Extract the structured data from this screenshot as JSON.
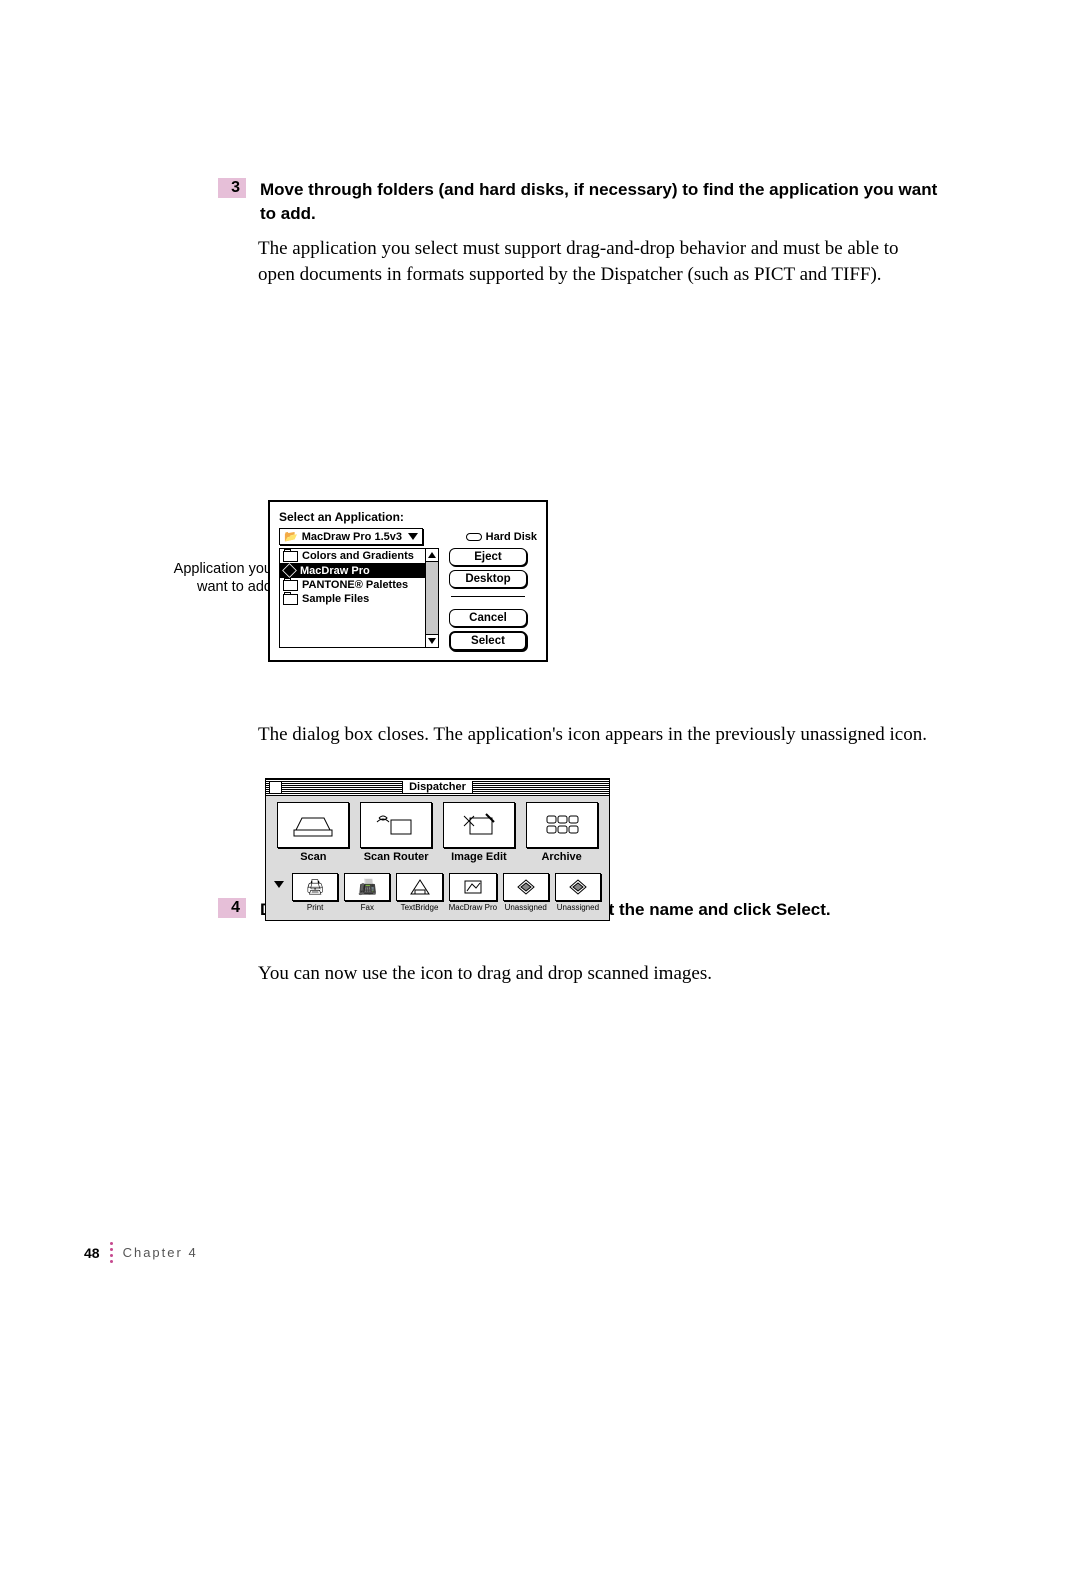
{
  "steps": {
    "s3": {
      "num": "3",
      "head": "Move through folders (and hard disks, if necessary) to find the application you want to add.",
      "para": "The application you select must support drag-and-drop behavior and must be able to open documents in formats supported by the Dispatcher (such as PICT and TIFF)."
    },
    "s4": {
      "num": "4",
      "head": "Double-click the application name, or select the name and click Select.",
      "para": "The dialog box closes. The application's icon appears in the previously unassigned icon."
    }
  },
  "callout": {
    "line1": "Application you",
    "line2": "want to add"
  },
  "dialog": {
    "title": "Select an Application:",
    "popup": "MacDraw Pro 1.5v3",
    "harddisk": "Hard Disk",
    "items": {
      "i0": "Colors and Gradients",
      "i1": "MacDraw Pro",
      "i2": "PANTONE® Palettes",
      "i3": "Sample Files"
    },
    "buttons": {
      "eject": "Eject",
      "desktop": "Desktop",
      "cancel": "Cancel",
      "select": "Select"
    }
  },
  "dispatcher": {
    "title": "Dispatcher",
    "big": {
      "scan": "Scan",
      "scan_router": "Scan Router",
      "image_edit": "Image Edit",
      "archive": "Archive"
    },
    "small": {
      "print": "Print",
      "fax": "Fax",
      "textbridge": "TextBridge",
      "macdraw": "MacDraw Pro",
      "un1": "Unassigned",
      "un2": "Unassigned"
    }
  },
  "after_para": "You can now use the icon to drag and drop scanned images.",
  "footer": {
    "page": "48",
    "chapter": "Chapter 4"
  }
}
